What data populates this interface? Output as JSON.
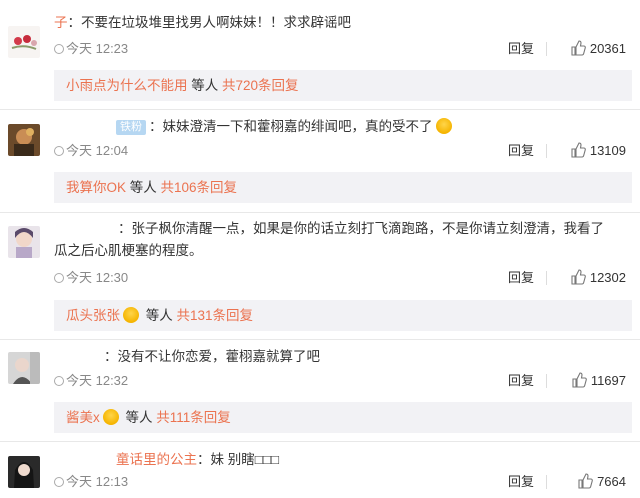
{
  "comments": [
    {
      "user": "子",
      "badge": "",
      "text": "：不要在垃圾堆里找男人啊妹妹！！求求辟谣吧",
      "time": "今天 12:23",
      "reply_label": "回复",
      "likes": "20361",
      "sub": {
        "who": "小雨点为什么不能用",
        "mid": " 等人 ",
        "count": "共720条回复"
      }
    },
    {
      "user": "",
      "badge": "铁粉",
      "text": "：妹妹澄清一下和藿栩嘉的绯闻吧，真的受不了",
      "time": "今天 12:04",
      "reply_label": "回复",
      "likes": "13109",
      "sub": {
        "who": "我算你OK",
        "mid": " 等人 ",
        "count": "共106条回复"
      }
    },
    {
      "user": "",
      "badge": "",
      "text_line1": "：张子枫你清醒一点，如果是你的话立刻打飞滴跑路，不是你请立刻澄清，我看了",
      "text_line2": "瓜之后心肌梗塞的程度。",
      "time": "今天 12:30",
      "reply_label": "回复",
      "likes": "12302",
      "sub": {
        "who": "瓜头张张",
        "mid": " 等人 ",
        "count": "共131条回复"
      }
    },
    {
      "user": "",
      "badge": "",
      "text": "：没有不让你恋爱，藿栩嘉就算了吧",
      "time": "今天 12:32",
      "reply_label": "回复",
      "likes": "11697",
      "sub": {
        "who": "酱美x",
        "mid": " 等人 ",
        "count": "共111条回复"
      }
    },
    {
      "user": "童话里的公主",
      "badge": "",
      "text": "：妹 别瞎□□□",
      "time": "今天 12:13",
      "reply_label": "回复",
      "likes": "7664"
    }
  ],
  "colors": {
    "link": "#eb7350",
    "subbg": "#f2f2f5",
    "badge": "#b6d7f2"
  }
}
